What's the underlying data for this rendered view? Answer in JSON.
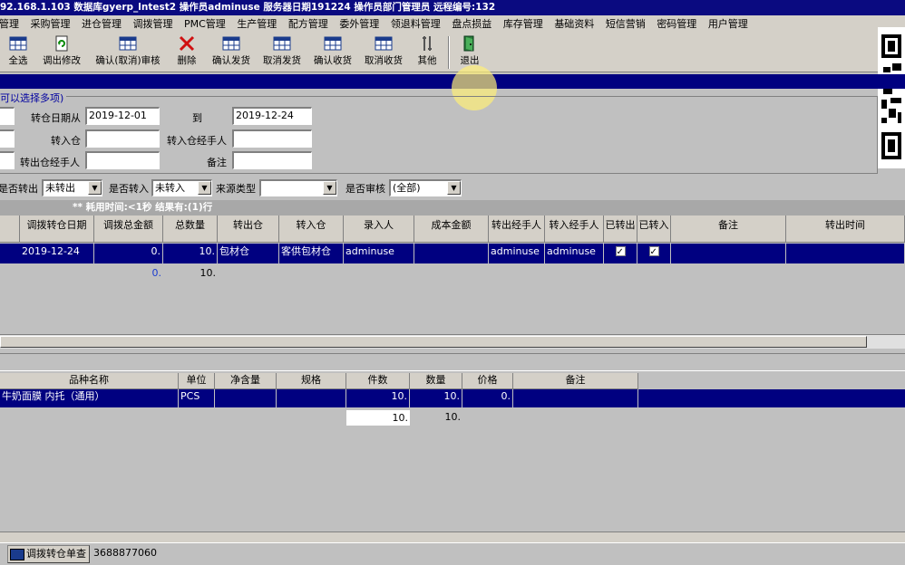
{
  "titlebar": {
    "text": "92.168.1.103  数据库gyerp_lntest2  操作员adminuse  服务器日期191224  操作员部门管理员 远程编号:132"
  },
  "menu": [
    "购管理",
    "采购管理",
    "进仓管理",
    "调拨管理",
    "PMC管理",
    "生产管理",
    "配方管理",
    "委外管理",
    "领退料管理",
    "盘点损益",
    "库存管理",
    "基础资料",
    "短信营销",
    "密码管理",
    "用户管理"
  ],
  "toolbar": {
    "buttons": [
      {
        "label": "全选",
        "icon": "grid-icon"
      },
      {
        "label": "调出修改",
        "icon": "refresh-doc-icon"
      },
      {
        "label": "确认(取消)审核",
        "icon": "grid-icon"
      },
      {
        "label": "删除",
        "icon": "delete-x-icon"
      },
      {
        "label": "确认发货",
        "icon": "grid-icon"
      },
      {
        "label": "取消发货",
        "icon": "grid-icon"
      },
      {
        "label": "确认收货",
        "icon": "grid-icon"
      },
      {
        "label": "取消收货",
        "icon": "grid-icon"
      },
      {
        "label": "其他",
        "icon": "tools-icon"
      },
      {
        "label": "退出",
        "icon": "exit-door-icon"
      }
    ]
  },
  "criteria": {
    "group_label": "可以选择多项)",
    "date_from_label": "转仓日期从",
    "date_from": "2019-12-01",
    "date_to_label": "到",
    "date_to": "2019-12-24",
    "in_wh_label": "转入仓",
    "in_wh": "",
    "in_handler_label": "转入仓经手人",
    "in_handler": "",
    "out_handler_label": "转出仓经手人",
    "out_handler": "",
    "remark_label": "备注",
    "remark": ""
  },
  "filters": {
    "is_out_label": "是否转出",
    "is_out": "未转出",
    "is_in_label": "是否转入",
    "is_in": "未转入",
    "source_label": "来源类型",
    "source": "",
    "audit_label": "是否审核",
    "audit": "(全部)"
  },
  "status": {
    "text": "** 耗用时间:<1秒  结果有:(1)行"
  },
  "grid1": {
    "headers": [
      "调拨转仓日期",
      "调拨总金额",
      "总数量",
      "转出仓",
      "转入仓",
      "录入人",
      "成本金额",
      "转出经手人",
      "转入经手人",
      "已转出",
      "已转入",
      "备注",
      "转出时间"
    ],
    "row": {
      "date": "2019-12-24",
      "amount": "0.",
      "qty": "10.",
      "out_wh": "包材仓",
      "in_wh": "客供包材仓",
      "entry": "adminuse",
      "cost": "",
      "out_handler": "adminuse",
      "in_handler": "adminuse",
      "out_done": true,
      "in_done": true,
      "remark": "",
      "out_time": ""
    },
    "totals": {
      "amount": "0.",
      "qty": "10."
    }
  },
  "grid2": {
    "headers": [
      "品种名称",
      "单位",
      "净含量",
      "规格",
      "件数",
      "数量",
      "价格",
      "备注"
    ],
    "row": {
      "name": "牛奶面膜 内托（通用）",
      "unit": "PCS",
      "net": "",
      "spec": "",
      "pieces": "10.",
      "qty": "10.",
      "price": "0.",
      "remark": ""
    },
    "totals": {
      "pieces": "10.",
      "qty": "10."
    }
  },
  "taskbar": {
    "button": "调拨转仓单查",
    "info": "3688877060"
  }
}
